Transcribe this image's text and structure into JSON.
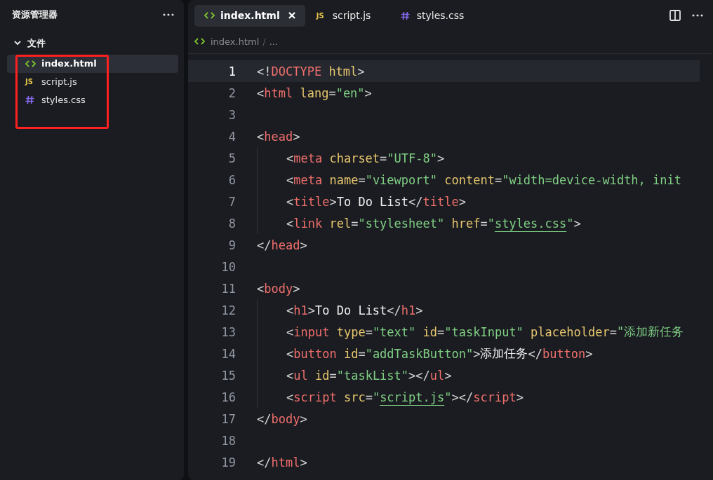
{
  "sidebar": {
    "title": "资源管理器",
    "section": {
      "label": "文件",
      "expanded": true
    },
    "files": [
      {
        "kind": "html",
        "name": "index.html",
        "selected": true
      },
      {
        "kind": "js",
        "icon_text": "JS",
        "name": "script.js",
        "selected": false
      },
      {
        "kind": "css",
        "name": "styles.css",
        "selected": false
      }
    ]
  },
  "annotations": [
    {
      "kind": "rectangle",
      "color": "#ff2020"
    }
  ],
  "tabs": [
    {
      "kind": "html",
      "label": "index.html",
      "selected": true,
      "closable": true
    },
    {
      "kind": "js",
      "icon_text": "JS",
      "label": "script.js",
      "selected": false,
      "closable": false
    },
    {
      "kind": "css",
      "label": "styles.css",
      "selected": false,
      "closable": false
    }
  ],
  "breadcrumb": {
    "kind": "html",
    "file": "index.html",
    "separator": "/",
    "rest": "..."
  },
  "code_lines": [
    {
      "number": "1",
      "current": true,
      "indented": false,
      "tokens": [
        {
          "kind": "punct",
          "text": "<!"
        },
        {
          "kind": "tag",
          "text": "DOCTYPE"
        },
        {
          "kind": "attr",
          "text": " html"
        },
        {
          "kind": "punct",
          "text": ">"
        }
      ]
    },
    {
      "number": "2",
      "current": false,
      "indented": false,
      "tokens": [
        {
          "kind": "punct",
          "text": "<"
        },
        {
          "kind": "tag",
          "text": "html"
        },
        {
          "kind": "attr",
          "text": " lang"
        },
        {
          "kind": "punct",
          "text": "="
        },
        {
          "kind": "string",
          "text": "\"en\""
        },
        {
          "kind": "punct",
          "text": ">"
        }
      ]
    },
    {
      "number": "3",
      "current": false
    },
    {
      "number": "4",
      "current": false,
      "indented": false,
      "tokens": [
        {
          "kind": "punct",
          "text": "<"
        },
        {
          "kind": "tag",
          "text": "head"
        },
        {
          "kind": "punct",
          "text": ">"
        }
      ]
    },
    {
      "number": "5",
      "current": false,
      "indented": true,
      "tokens": [
        {
          "kind": "punct",
          "text": "<"
        },
        {
          "kind": "tag",
          "text": "meta"
        },
        {
          "kind": "attr",
          "text": " charset"
        },
        {
          "kind": "punct",
          "text": "="
        },
        {
          "kind": "string",
          "text": "\"UTF-8\""
        },
        {
          "kind": "punct",
          "text": ">"
        }
      ]
    },
    {
      "number": "6",
      "current": false,
      "indented": true,
      "tokens": [
        {
          "kind": "punct",
          "text": "<"
        },
        {
          "kind": "tag",
          "text": "meta"
        },
        {
          "kind": "attr",
          "text": " name"
        },
        {
          "kind": "punct",
          "text": "="
        },
        {
          "kind": "string",
          "text": "\"viewport\""
        },
        {
          "kind": "attr",
          "text": " content"
        },
        {
          "kind": "punct",
          "text": "="
        },
        {
          "kind": "string",
          "text": "\"width=device-width, init"
        }
      ]
    },
    {
      "number": "7",
      "current": false,
      "indented": true,
      "tokens": [
        {
          "kind": "punct",
          "text": "<"
        },
        {
          "kind": "tag",
          "text": "title"
        },
        {
          "kind": "punct",
          "text": ">"
        },
        {
          "kind": "text",
          "text": "To Do List"
        },
        {
          "kind": "punct",
          "text": "</"
        },
        {
          "kind": "tag",
          "text": "title"
        },
        {
          "kind": "punct",
          "text": ">"
        }
      ]
    },
    {
      "number": "8",
      "current": false,
      "indented": true,
      "tokens": [
        {
          "kind": "punct",
          "text": "<"
        },
        {
          "kind": "tag",
          "text": "link"
        },
        {
          "kind": "attr",
          "text": " rel"
        },
        {
          "kind": "punct",
          "text": "="
        },
        {
          "kind": "string",
          "text": "\"stylesheet\""
        },
        {
          "kind": "attr",
          "text": " href"
        },
        {
          "kind": "punct",
          "text": "="
        },
        {
          "kind": "string",
          "text": "\""
        },
        {
          "kind": "link",
          "text": "styles.css"
        },
        {
          "kind": "string",
          "text": "\""
        },
        {
          "kind": "punct",
          "text": ">"
        }
      ]
    },
    {
      "number": "9",
      "current": false,
      "indented": false,
      "tokens": [
        {
          "kind": "punct",
          "text": "</"
        },
        {
          "kind": "tag",
          "text": "head"
        },
        {
          "kind": "punct",
          "text": ">"
        }
      ]
    },
    {
      "number": "10",
      "current": false
    },
    {
      "number": "11",
      "current": false,
      "indented": false,
      "tokens": [
        {
          "kind": "punct",
          "text": "<"
        },
        {
          "kind": "tag",
          "text": "body"
        },
        {
          "kind": "punct",
          "text": ">"
        }
      ]
    },
    {
      "number": "12",
      "current": false,
      "indented": true,
      "tokens": [
        {
          "kind": "punct",
          "text": "<"
        },
        {
          "kind": "tag",
          "text": "h1"
        },
        {
          "kind": "punct",
          "text": ">"
        },
        {
          "kind": "text",
          "text": "To Do List"
        },
        {
          "kind": "punct",
          "text": "</"
        },
        {
          "kind": "tag",
          "text": "h1"
        },
        {
          "kind": "punct",
          "text": ">"
        }
      ]
    },
    {
      "number": "13",
      "current": false,
      "indented": true,
      "tokens": [
        {
          "kind": "punct",
          "text": "<"
        },
        {
          "kind": "tag",
          "text": "input"
        },
        {
          "kind": "attr",
          "text": " type"
        },
        {
          "kind": "punct",
          "text": "="
        },
        {
          "kind": "string",
          "text": "\"text\""
        },
        {
          "kind": "attr",
          "text": " id"
        },
        {
          "kind": "punct",
          "text": "="
        },
        {
          "kind": "string",
          "text": "\"taskInput\""
        },
        {
          "kind": "attr",
          "text": " placeholder"
        },
        {
          "kind": "punct",
          "text": "="
        },
        {
          "kind": "string",
          "text": "\"添加新任务"
        }
      ]
    },
    {
      "number": "14",
      "current": false,
      "indented": true,
      "tokens": [
        {
          "kind": "punct",
          "text": "<"
        },
        {
          "kind": "tag",
          "text": "button"
        },
        {
          "kind": "attr",
          "text": " id"
        },
        {
          "kind": "punct",
          "text": "="
        },
        {
          "kind": "string",
          "text": "\"addTaskButton\""
        },
        {
          "kind": "punct",
          "text": ">"
        },
        {
          "kind": "text",
          "text": "添加任务"
        },
        {
          "kind": "punct",
          "text": "</"
        },
        {
          "kind": "tag",
          "text": "button"
        },
        {
          "kind": "punct",
          "text": ">"
        }
      ]
    },
    {
      "number": "15",
      "current": false,
      "indented": true,
      "tokens": [
        {
          "kind": "punct",
          "text": "<"
        },
        {
          "kind": "tag",
          "text": "ul"
        },
        {
          "kind": "attr",
          "text": " id"
        },
        {
          "kind": "punct",
          "text": "="
        },
        {
          "kind": "string",
          "text": "\"taskList\""
        },
        {
          "kind": "punct",
          "text": "></"
        },
        {
          "kind": "tag",
          "text": "ul"
        },
        {
          "kind": "punct",
          "text": ">"
        }
      ]
    },
    {
      "number": "16",
      "current": false,
      "indented": true,
      "tokens": [
        {
          "kind": "punct",
          "text": "<"
        },
        {
          "kind": "tag",
          "text": "script"
        },
        {
          "kind": "attr",
          "text": " src"
        },
        {
          "kind": "punct",
          "text": "="
        },
        {
          "kind": "string",
          "text": "\""
        },
        {
          "kind": "link",
          "text": "script.js"
        },
        {
          "kind": "string",
          "text": "\""
        },
        {
          "kind": "punct",
          "text": "></"
        },
        {
          "kind": "tag",
          "text": "script"
        },
        {
          "kind": "punct",
          "text": ">"
        }
      ]
    },
    {
      "number": "17",
      "current": false,
      "indented": false,
      "tokens": [
        {
          "kind": "punct",
          "text": "</"
        },
        {
          "kind": "tag",
          "text": "body"
        },
        {
          "kind": "punct",
          "text": ">"
        }
      ]
    },
    {
      "number": "18",
      "current": false
    },
    {
      "number": "19",
      "current": false,
      "indented": false,
      "tokens": [
        {
          "kind": "punct",
          "text": "</"
        },
        {
          "kind": "tag",
          "text": "html"
        },
        {
          "kind": "punct",
          "text": ">"
        }
      ]
    }
  ]
}
